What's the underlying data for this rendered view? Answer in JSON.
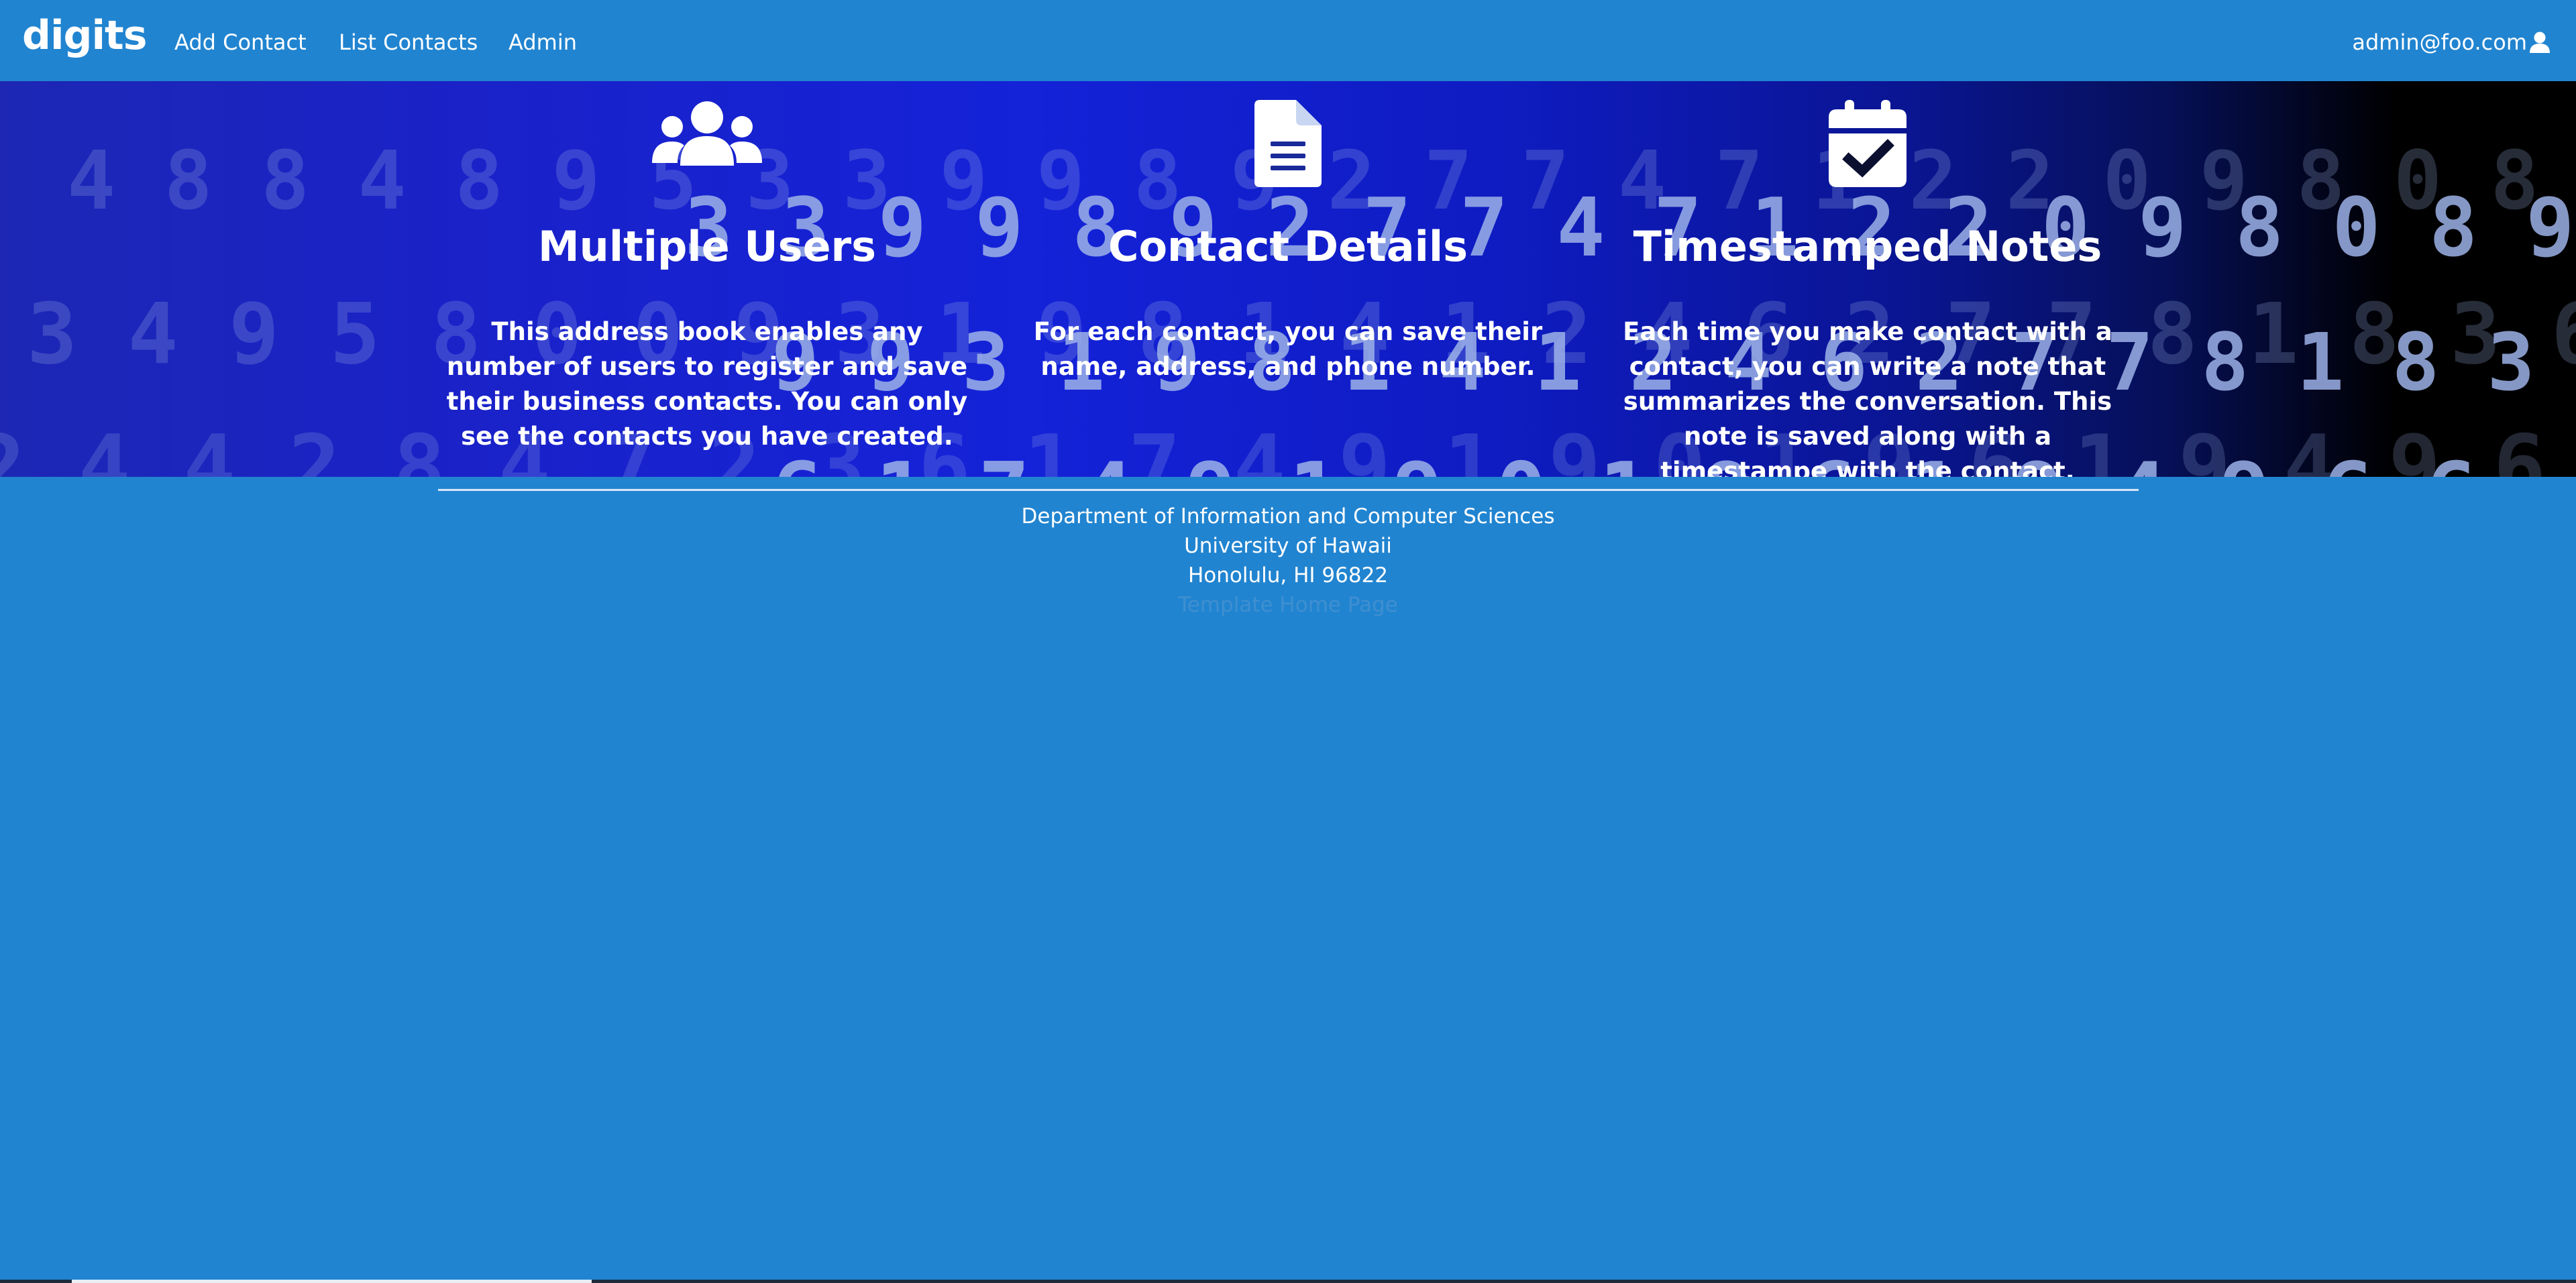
{
  "navbar": {
    "brand": "digits",
    "links": [
      "Add Contact",
      "List Contacts",
      "Admin"
    ],
    "user_email": "admin@foo.com",
    "user_icon": "user-icon"
  },
  "hero": {
    "features": [
      {
        "icon": "users-icon",
        "title": "Multiple Users",
        "description": "This address book enables any number of users to register and save their business contacts. You can only see the contacts you have created."
      },
      {
        "icon": "file-text-icon",
        "title": "Contact Details",
        "description": "For each contact, you can save their name, address, and phone number."
      },
      {
        "icon": "calendar-check-icon",
        "title": "Timestamped Notes",
        "description": "Each time you make contact with a contact, you can write a note that summarizes the conversation. This note is saved along with a timestampe with the contact."
      }
    ]
  },
  "footer": {
    "department": "Department of Information and Computer Sciences",
    "university": "University of Hawaii",
    "location": "Honolulu, HI 96822",
    "link": "Template Home Page"
  },
  "colors": {
    "brand_blue": "#2184d0",
    "hero_blue": "#1422d8",
    "text": "#ffffff"
  }
}
